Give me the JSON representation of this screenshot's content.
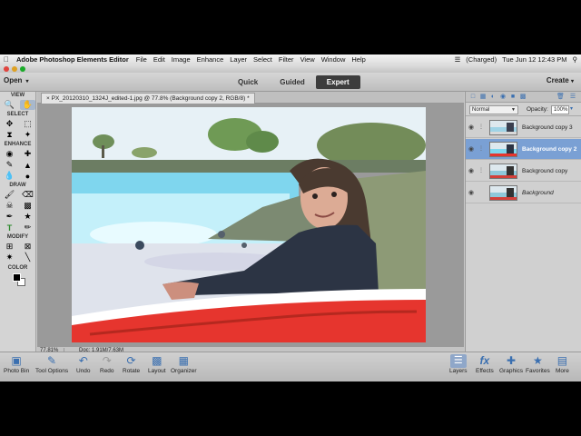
{
  "menubar": {
    "app_name": "Adobe Photoshop Elements Editor",
    "items": [
      "File",
      "Edit",
      "Image",
      "Enhance",
      "Layer",
      "Select",
      "Filter",
      "View",
      "Window",
      "Help"
    ],
    "battery": "(Charged)",
    "clock": "Tue Jun 12  12:43 PM"
  },
  "topbar": {
    "open_label": "Open",
    "modes": [
      "Quick",
      "Guided",
      "Expert"
    ],
    "active_mode": "Expert",
    "create_label": "Create"
  },
  "toolbox": {
    "sections": {
      "view": "VIEW",
      "select": "SELECT",
      "enhance": "ENHANCE",
      "draw": "DRAW",
      "modify": "MODIFY",
      "color": "COLOR"
    }
  },
  "document": {
    "tab_title": "PX_20120310_1324J_edited-1.jpg @ 77.8% (Background copy 2, RGB/8) *",
    "zoom": "77.81%",
    "doc_size": "Doc: 1.91M/7.63M"
  },
  "layers_panel": {
    "blend_mode": "Normal",
    "opacity_label": "Opacity:",
    "opacity_value": "100%",
    "layers": [
      {
        "name": "Background copy 3",
        "selected": false
      },
      {
        "name": "Background copy 2",
        "selected": true
      },
      {
        "name": "Background copy",
        "selected": false
      },
      {
        "name": "Background",
        "selected": false
      }
    ]
  },
  "bottombar": {
    "left": [
      "Photo Bin",
      "Tool Options",
      "Undo",
      "Redo",
      "Rotate",
      "Layout",
      "Organizer"
    ],
    "right": [
      "Layers",
      "Effects",
      "Graphics",
      "Favorites",
      "More"
    ]
  }
}
